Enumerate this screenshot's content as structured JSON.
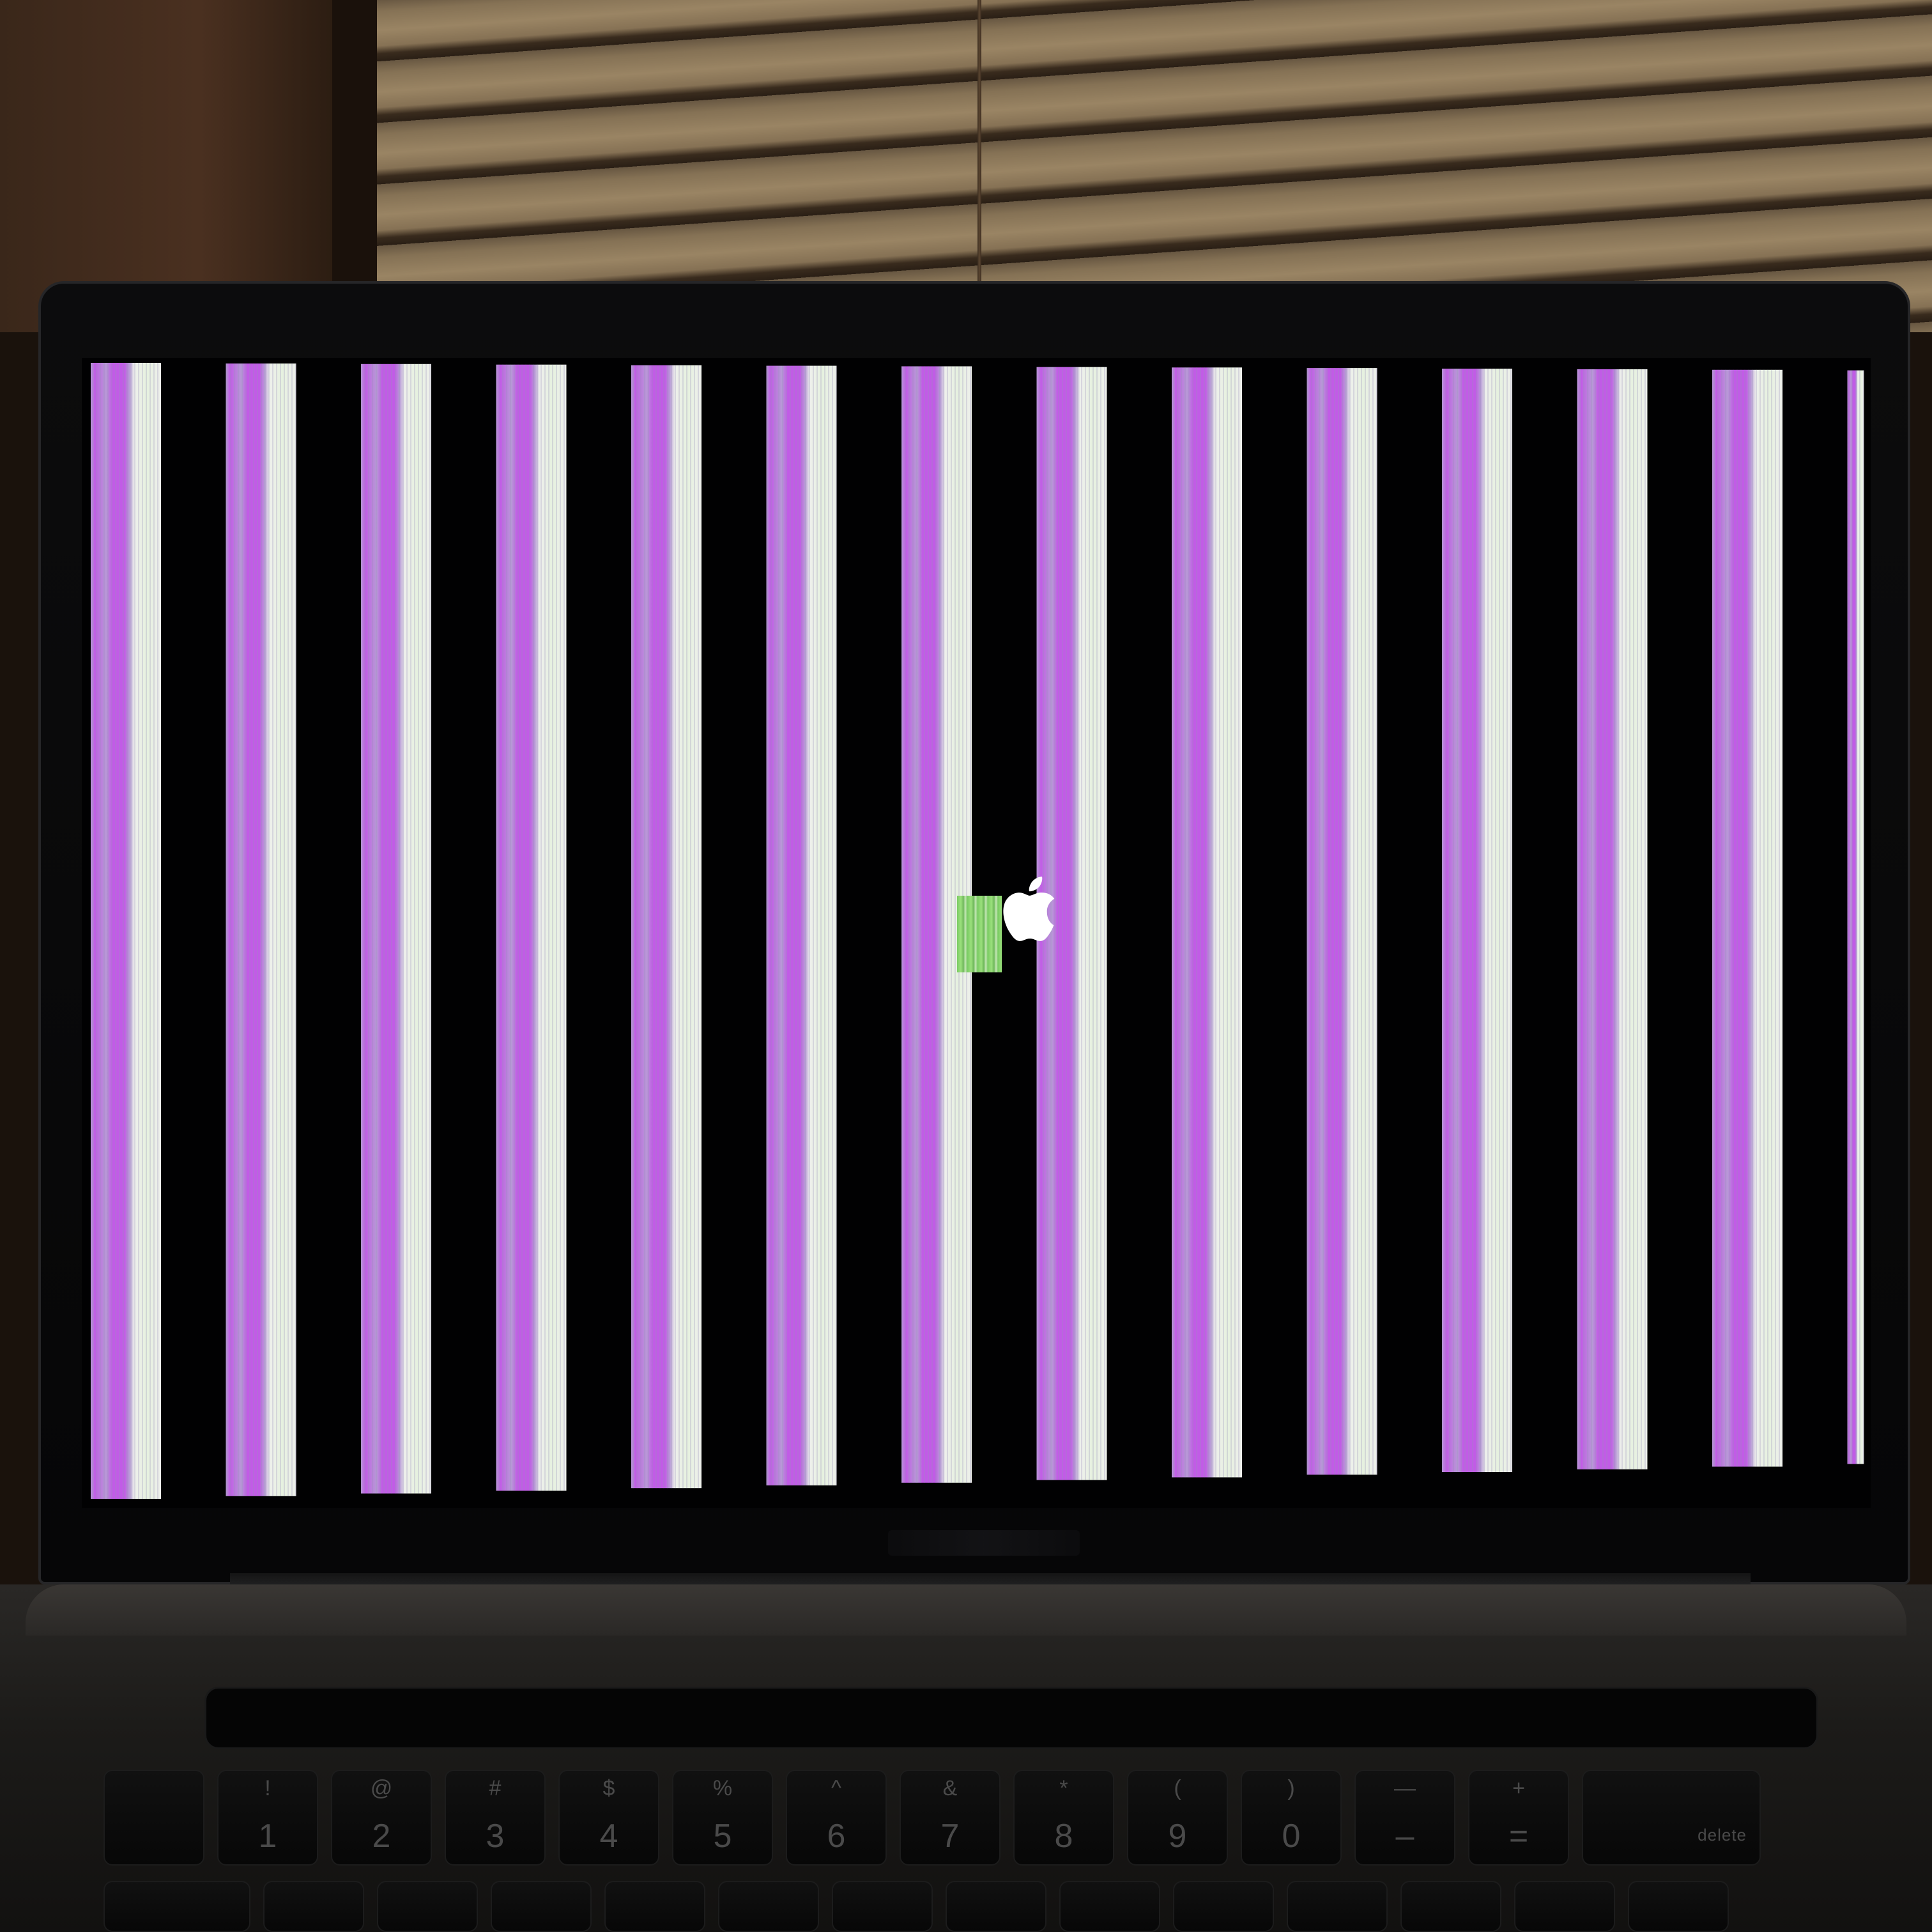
{
  "scene": {
    "description_type": "photo",
    "subject": "laptop-with-display-artifacts"
  },
  "screen": {
    "background_color": "#010102",
    "stripe_count": 14,
    "stripe_colors": {
      "magenta": "#c15ce6",
      "lavender": "#b79ad6",
      "white": "#eef0ec",
      "pale_green": "#e6f1df",
      "glitch_green": "#8fd86f"
    },
    "logo": "apple-logo-icon"
  },
  "keyboard": {
    "number_row": [
      {
        "top": "!",
        "bottom": "1"
      },
      {
        "top": "@",
        "bottom": "2"
      },
      {
        "top": "#",
        "bottom": "3"
      },
      {
        "top": "$",
        "bottom": "4"
      },
      {
        "top": "%",
        "bottom": "5"
      },
      {
        "top": "^",
        "bottom": "6"
      },
      {
        "top": "&",
        "bottom": "7"
      },
      {
        "top": "*",
        "bottom": "8"
      },
      {
        "top": "(",
        "bottom": "9"
      },
      {
        "top": ")",
        "bottom": "0"
      },
      {
        "top": "—",
        "bottom": "–"
      },
      {
        "top": "+",
        "bottom": "="
      }
    ],
    "delete_label": "delete",
    "escape_key": "escape-key"
  }
}
